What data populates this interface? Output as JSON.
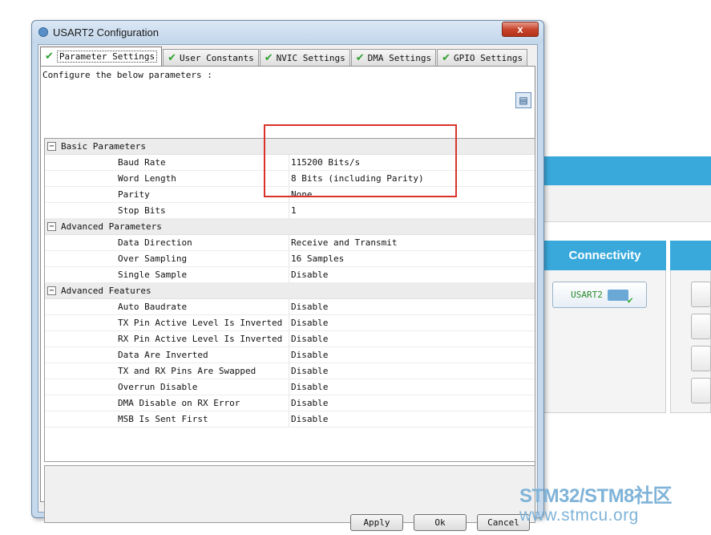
{
  "background_app": {
    "panel_title": "Connectivity",
    "peripheral_button": "USART2"
  },
  "window": {
    "title": "USART2 Configuration",
    "close_label": "x"
  },
  "tabs": [
    {
      "label": "Parameter Settings",
      "active": true
    },
    {
      "label": "User Constants",
      "active": false
    },
    {
      "label": "NVIC Settings",
      "active": false
    },
    {
      "label": "DMA Settings",
      "active": false
    },
    {
      "label": "GPIO Settings",
      "active": false
    }
  ],
  "intro_text": "Configure the below parameters :",
  "sections": [
    {
      "title": "Basic Parameters",
      "params": [
        {
          "name": "Baud Rate",
          "value": "115200 Bits/s"
        },
        {
          "name": "Word Length",
          "value": "8 Bits (including Parity)"
        },
        {
          "name": "Parity",
          "value": "None"
        },
        {
          "name": "Stop Bits",
          "value": "1"
        }
      ]
    },
    {
      "title": "Advanced Parameters",
      "params": [
        {
          "name": "Data Direction",
          "value": "Receive and Transmit"
        },
        {
          "name": "Over Sampling",
          "value": "16 Samples"
        },
        {
          "name": "Single Sample",
          "value": "Disable"
        }
      ]
    },
    {
      "title": "Advanced Features",
      "params": [
        {
          "name": "Auto Baudrate",
          "value": "Disable"
        },
        {
          "name": "TX Pin Active Level Is Inverted",
          "value": "Disable"
        },
        {
          "name": "RX Pin Active Level Is Inverted",
          "value": "Disable"
        },
        {
          "name": "Data Are Inverted",
          "value": "Disable"
        },
        {
          "name": "TX and RX Pins Are Swapped",
          "value": "Disable"
        },
        {
          "name": "Overrun Disable",
          "value": "Disable"
        },
        {
          "name": "DMA Disable on RX Error",
          "value": "Disable"
        },
        {
          "name": "MSB Is Sent First",
          "value": "Disable"
        }
      ]
    }
  ],
  "buttons": {
    "apply": "Apply",
    "ok": "Ok",
    "cancel": "Cancel"
  },
  "watermark": {
    "line1": "STM32/STM8社区",
    "line2": "www.stmcu.org"
  },
  "colors": {
    "accent_blue": "#39a9dc",
    "highlight_red": "#d9332b",
    "check_green": "#2ea02e"
  }
}
